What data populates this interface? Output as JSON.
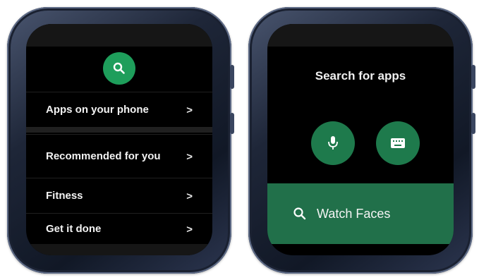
{
  "left_screen": {
    "rows": [
      {
        "label": "Apps on your phone",
        "chevron": ">"
      },
      {
        "label": "Recommended for you",
        "chevron": ">"
      },
      {
        "label": "Fitness",
        "chevron": ">"
      },
      {
        "label": "Get it done",
        "chevron": ">"
      }
    ],
    "search_icon": "search-icon"
  },
  "right_screen": {
    "title": "Search for apps",
    "voice_icon": "microphone-icon",
    "keyboard_icon": "keyboard-icon",
    "suggestion": "Watch Faces"
  },
  "colors": {
    "accent_green": "#1e9e5b",
    "button_green": "#1e7a4c",
    "suggestion_green": "#21704a",
    "bezel": "#1e2638"
  }
}
